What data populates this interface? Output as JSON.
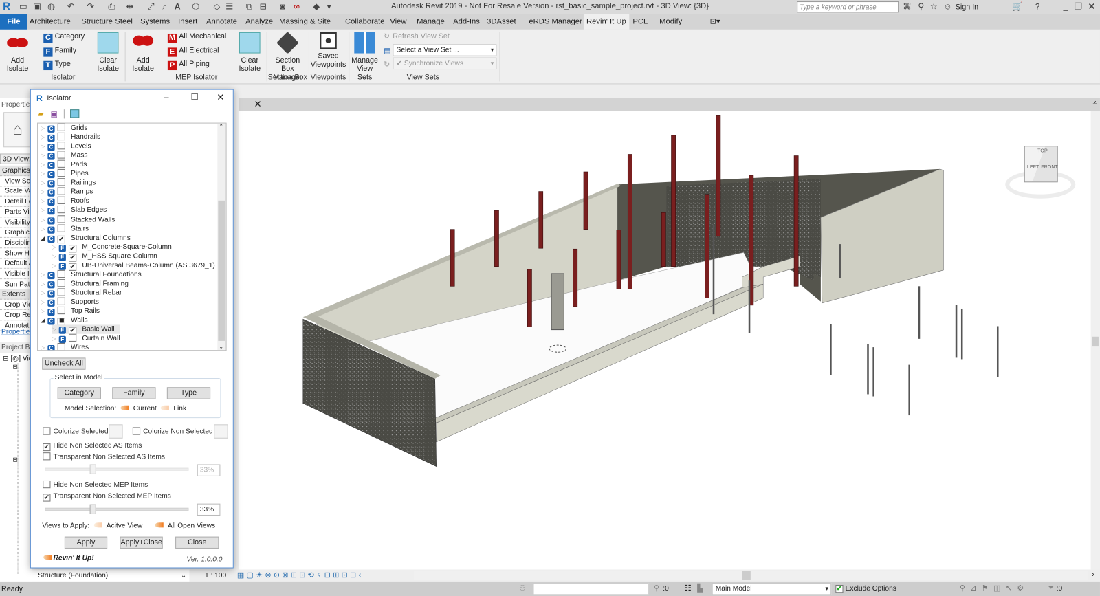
{
  "window": {
    "title": "Autodesk Revit 2019 - Not For Resale Version - rst_basic_sample_project.rvt - 3D View: {3D}",
    "search_placeholder": "Type a keyword or phrase",
    "sign_in": "Sign In"
  },
  "tabs": [
    "File",
    "Architecture",
    "Structure",
    "Steel",
    "Systems",
    "Insert",
    "Annotate",
    "Analyze",
    "Massing & Site",
    "Collaborate",
    "View",
    "Manage",
    "Add-Ins",
    "3DAsset",
    "eRDS Manager",
    "Revin' It Up",
    "PCL",
    "Modify"
  ],
  "active_tab": "Revin' It Up",
  "ribbon": {
    "isolator": {
      "label": "Isolator",
      "add": "Add Isolate",
      "category": "Category",
      "family": "Family",
      "type": "Type",
      "clear": "Clear Isolate"
    },
    "mep": {
      "label": "MEP Isolator",
      "add": "Add Isolate",
      "mech": "All Mechanical",
      "elec": "All Electrical",
      "piping": "All Piping",
      "clear": "Clear Isolate"
    },
    "section_box": {
      "label": "Section Box",
      "manager": "Section Box Manager"
    },
    "viewpoints": {
      "label": "Viewpoints",
      "saved": "Saved Viewpoints"
    },
    "view_sets": {
      "label": "View Sets",
      "manage": "Manage View Sets",
      "refresh": "Refresh View Set",
      "select": "Select a View Set ...",
      "sync": "Synchronize Views"
    }
  },
  "properties": {
    "title": "Properties",
    "view_type": "3D View:",
    "rows": [
      "Graphics",
      "View Scale",
      "Scale Value",
      "Detail Level",
      "Parts Visibility",
      "Visibility/Graphics",
      "Graphic Display",
      "Discipline",
      "Show Hidden Lines",
      "Default Analysis",
      "Visible In Option",
      "Sun Path",
      "Extents",
      "Crop View",
      "Crop Region",
      "Annotation Crop"
    ],
    "help_link": "Properties help"
  },
  "project_browser": {
    "title": "Project Browser",
    "root": "Views",
    "bottom_item": "Structure (Foundation)"
  },
  "dialog": {
    "title": "Isolator",
    "tree": [
      {
        "label": "Grids",
        "level": 0,
        "checked": false
      },
      {
        "label": "Handrails",
        "level": 0,
        "checked": false
      },
      {
        "label": "Levels",
        "level": 0,
        "checked": false
      },
      {
        "label": "Mass",
        "level": 0,
        "checked": false
      },
      {
        "label": "Pads",
        "level": 0,
        "checked": false
      },
      {
        "label": "Pipes",
        "level": 0,
        "checked": false
      },
      {
        "label": "Railings",
        "level": 0,
        "checked": false
      },
      {
        "label": "Ramps",
        "level": 0,
        "checked": false
      },
      {
        "label": "Roofs",
        "level": 0,
        "checked": false
      },
      {
        "label": "Slab Edges",
        "level": 0,
        "checked": false
      },
      {
        "label": "Stacked Walls",
        "level": 0,
        "checked": false
      },
      {
        "label": "Stairs",
        "level": 0,
        "checked": false
      },
      {
        "label": "Structural Columns",
        "level": 0,
        "checked": true,
        "expanded": true
      },
      {
        "label": "M_Concrete-Square-Column",
        "level": 1,
        "checked": true
      },
      {
        "label": "M_HSS Square-Column",
        "level": 1,
        "checked": true
      },
      {
        "label": "UB-Universal Beams-Column (AS 3679_1)",
        "level": 1,
        "checked": true
      },
      {
        "label": "Structural Foundations",
        "level": 0,
        "checked": false
      },
      {
        "label": "Structural Framing",
        "level": 0,
        "checked": false
      },
      {
        "label": "Structural Rebar",
        "level": 0,
        "checked": false
      },
      {
        "label": "Supports",
        "level": 0,
        "checked": false
      },
      {
        "label": "Top Rails",
        "level": 0,
        "checked": false
      },
      {
        "label": "Walls",
        "level": 0,
        "checked": "partial",
        "expanded": true
      },
      {
        "label": "Basic Wall",
        "level": 1,
        "checked": true,
        "selected": true
      },
      {
        "label": "Curtain Wall",
        "level": 1,
        "checked": false
      },
      {
        "label": "Wires",
        "level": 0,
        "checked": false
      }
    ],
    "uncheck_all": "Uncheck All",
    "select_in_model": "Select in Model",
    "btn_category": "Category",
    "btn_family": "Family",
    "btn_type": "Type",
    "model_selection": "Model Selection:",
    "current": "Current",
    "link": "Link",
    "colorize_selected": "Colorize Selected",
    "colorize_non_selected": "Colorize Non Selected",
    "hide_as": "Hide Non Selected AS Items",
    "hide_as_checked": true,
    "transp_as": "Transparent Non Selected AS Items",
    "transp_as_checked": false,
    "transp_as_value": "33%",
    "transp_as_level": 33,
    "hide_mep": "Hide Non Selected MEP Items",
    "hide_mep_checked": false,
    "transp_mep": "Transparent Non Selected MEP Items",
    "transp_mep_checked": true,
    "transp_mep_value": "33%",
    "transp_mep_level": 33,
    "views_to_apply": "Views to Apply:",
    "active_view": "Acitve View",
    "all_open_views": "All Open Views",
    "apply": "Apply",
    "apply_close": "Apply+Close",
    "close": "Close",
    "brand": "Revin' It Up!",
    "version": "Ver. 1.0.0.0"
  },
  "viewcube": {
    "top": "TOP",
    "left": "LEFT",
    "front": "FRONT"
  },
  "view_control": {
    "scale": "1 : 100"
  },
  "status": {
    "text": "Ready",
    "selection_count": ":0",
    "workset": "Main Model",
    "exclude_options": "Exclude Options",
    "exclude_checked": true,
    "filter_count": ":0"
  }
}
